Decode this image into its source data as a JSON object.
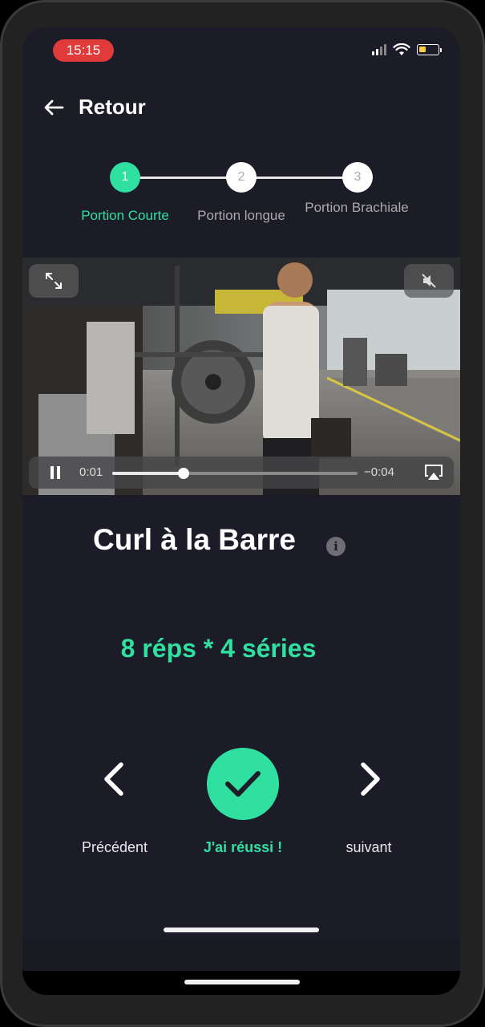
{
  "status_bar": {
    "time": "15:15",
    "battery_color": "#f5d23b",
    "time_pill_color": "#e03a3a"
  },
  "header": {
    "back_label": "Retour"
  },
  "stepper": {
    "steps": [
      {
        "number": "1",
        "label": "Portion Courte",
        "active": true
      },
      {
        "number": "2",
        "label": "Portion longue",
        "active": false
      },
      {
        "number": "3",
        "label": "Portion Brachiale",
        "active": false
      }
    ]
  },
  "video": {
    "current_time": "0:01",
    "remaining_time": "−0:04",
    "progress": 0.29,
    "icons": [
      "expand-icon",
      "mute-icon",
      "pause-icon",
      "airplay-icon"
    ]
  },
  "exercise": {
    "title": "Curl à la Barre",
    "info_icon": "i",
    "reps": "8 réps * 4 séries"
  },
  "actions": {
    "previous_label": "Précédent",
    "success_label": "J'ai réussi !",
    "next_label": "suivant"
  },
  "colors": {
    "accent": "#2fe0a0",
    "background": "#1c1b28"
  }
}
